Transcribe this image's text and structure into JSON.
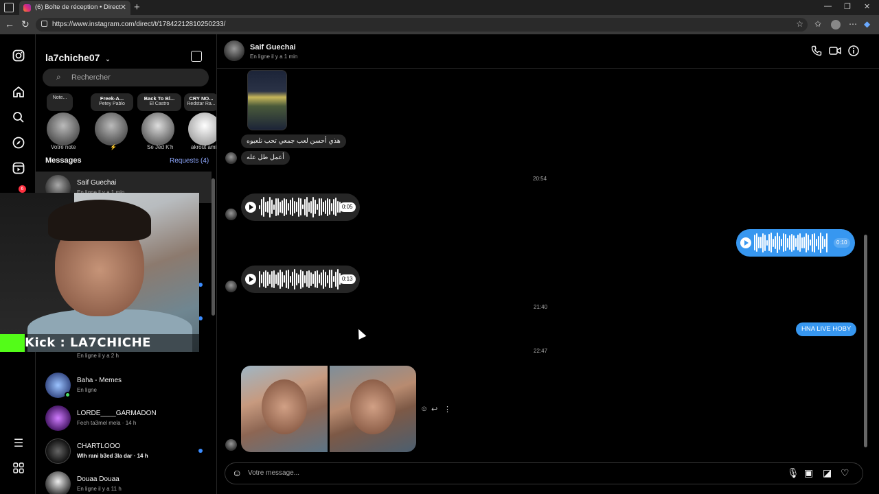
{
  "browser": {
    "tab_title": "(6) Boîte de réception • Direct",
    "url": "https://www.instagram.com/direct/t/17842212810250233/",
    "new_tab": "+",
    "tab_close": "✕"
  },
  "rail": {
    "badge": "6"
  },
  "inbox": {
    "username": "la7chiche07",
    "search_placeholder": "Rechercher",
    "messages_heading": "Messages",
    "requests_label": "Requests (4)",
    "notes": [
      {
        "text": "Note...",
        "title": "",
        "artist": "",
        "label": "Votre note"
      },
      {
        "text": "",
        "title": "Freek-A...",
        "artist": "Petey Pablo",
        "label": "⚡"
      },
      {
        "text": "",
        "title": "Back To Bl...",
        "artist": "El Castro",
        "label": "Se Jed K'h"
      },
      {
        "text": "",
        "title": "CRY NO...",
        "artist": "Redstar Ra...",
        "label": "akrout ami"
      }
    ],
    "conversations": [
      {
        "name": "Saif Guechai",
        "sub": "En ligne il y a 1 min",
        "unread": false,
        "online": false
      },
      {
        "name": "",
        "sub": "En ligne il y a 2 h",
        "unread": false,
        "online": false
      },
      {
        "name": "Baha - Memes",
        "sub": "En ligne",
        "unread": false,
        "online": true
      },
      {
        "name": "LORDE____GARMADON",
        "sub": "Fech ta3mel mela · 14 h",
        "unread": false,
        "online": false
      },
      {
        "name": "CHARTLOOO",
        "sub": "Wlh rani b3ed 3la dar · 14 h",
        "unread": true,
        "online": false
      },
      {
        "name": "Douaa Douaa",
        "sub": "En ligne il y a 11 h",
        "unread": false,
        "online": false
      }
    ]
  },
  "overlay": {
    "kick_text": "Kick : LA7CHICHE"
  },
  "chat": {
    "name": "Saif Guechai",
    "status": "En ligne il y a 1 min",
    "msg1": "هذي أحسن لعب جمعي تحب نلعبوه",
    "msg2": "أعمل طل عله",
    "time1": "20:54",
    "voice1_duration": "0:05",
    "voice2_duration": "0:10",
    "voice3_duration": "0:13",
    "time2": "21:40",
    "out_msg": "HNA LIVE HOBY",
    "time3": "22:47",
    "composer_placeholder": "Votre message..."
  }
}
